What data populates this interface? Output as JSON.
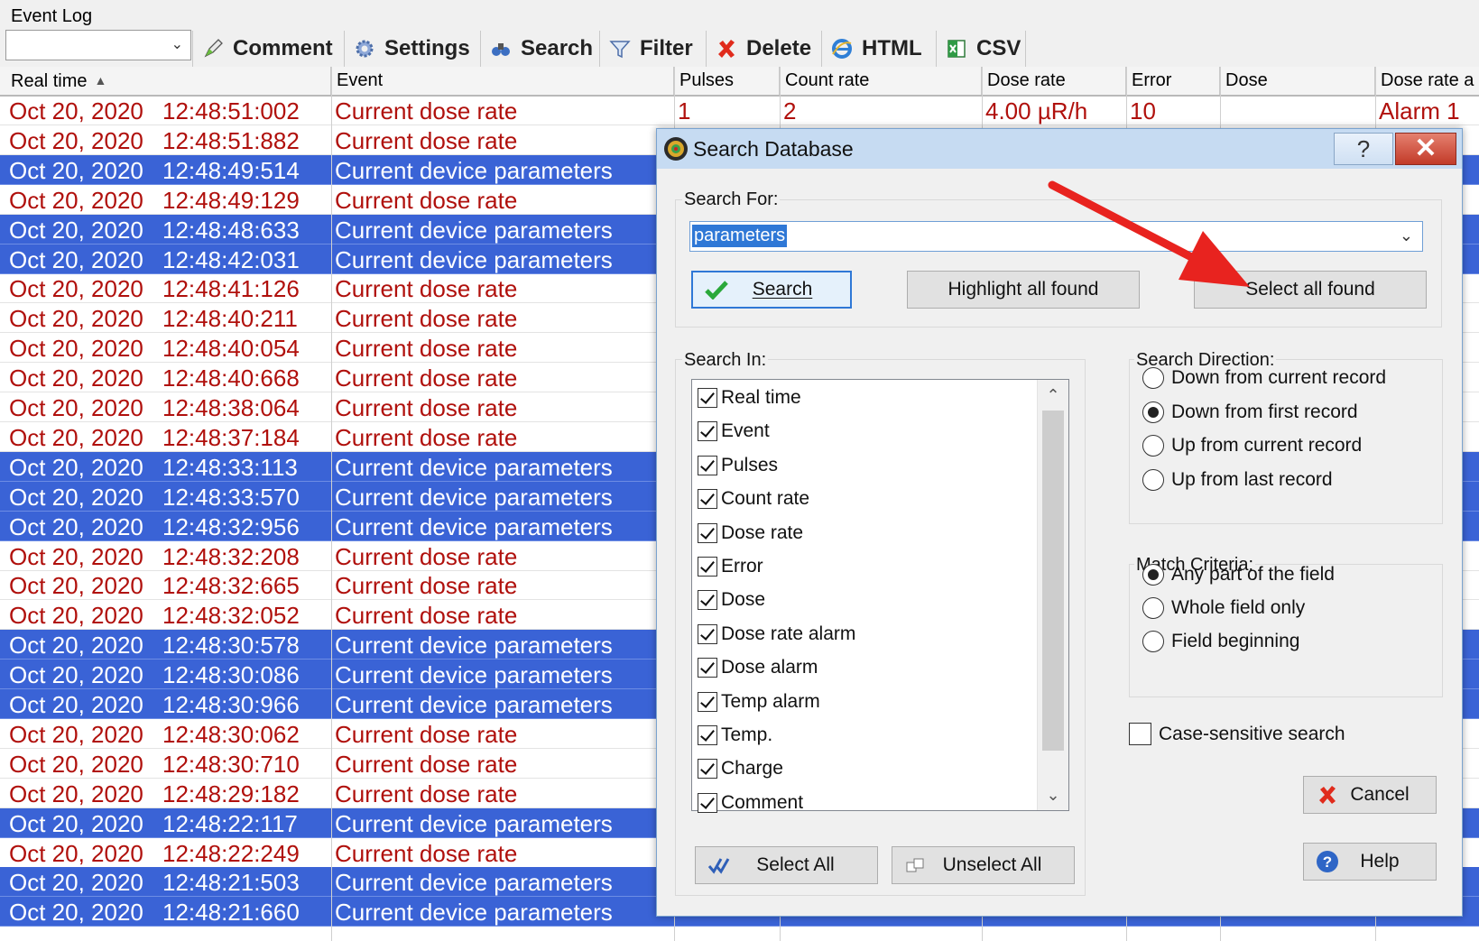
{
  "window": {
    "title": "Event Log"
  },
  "toolbar": {
    "combo_value": "",
    "buttons": [
      {
        "label": "Comment",
        "icon": "comment-icon"
      },
      {
        "label": "Settings",
        "icon": "gear-icon"
      },
      {
        "label": "Search",
        "icon": "binoculars-icon"
      },
      {
        "label": "Filter",
        "icon": "funnel-icon"
      },
      {
        "label": "Delete",
        "icon": "red-x-icon"
      },
      {
        "label": "HTML",
        "icon": "ie-icon"
      },
      {
        "label": "CSV",
        "icon": "excel-icon"
      }
    ]
  },
  "grid": {
    "columns": [
      "Real time",
      "Event",
      "Pulses",
      "Count rate",
      "Dose rate",
      "Error",
      "Dose",
      "Dose rate a"
    ],
    "sorted_column": "Real time",
    "colors": {
      "text": "#b0100c",
      "selected_bg": "#3a63d6",
      "selected_text": "#ffffff"
    },
    "first_row": {
      "pulses": "1",
      "count_rate": "2",
      "dose_rate": "4.00 µR/h",
      "error": "10",
      "dose": "",
      "alarm": "Alarm 1"
    },
    "rows": [
      {
        "date": "Oct 20, 2020",
        "time": "12:48:51:002",
        "event": "Current dose rate",
        "selected": false
      },
      {
        "date": "Oct 20, 2020",
        "time": "12:48:51:882",
        "event": "Current dose rate",
        "selected": false
      },
      {
        "date": "Oct 20, 2020",
        "time": "12:48:49:514",
        "event": "Current device parameters",
        "selected": true
      },
      {
        "date": "Oct 20, 2020",
        "time": "12:48:49:129",
        "event": "Current dose rate",
        "selected": false
      },
      {
        "date": "Oct 20, 2020",
        "time": "12:48:48:633",
        "event": "Current device parameters",
        "selected": true
      },
      {
        "date": "Oct 20, 2020",
        "time": "12:48:42:031",
        "event": "Current device parameters",
        "selected": true
      },
      {
        "date": "Oct 20, 2020",
        "time": "12:48:41:126",
        "event": "Current dose rate",
        "selected": false
      },
      {
        "date": "Oct 20, 2020",
        "time": "12:48:40:211",
        "event": "Current dose rate",
        "selected": false
      },
      {
        "date": "Oct 20, 2020",
        "time": "12:48:40:054",
        "event": "Current dose rate",
        "selected": false
      },
      {
        "date": "Oct 20, 2020",
        "time": "12:48:40:668",
        "event": "Current dose rate",
        "selected": false
      },
      {
        "date": "Oct 20, 2020",
        "time": "12:48:38:064",
        "event": "Current dose rate",
        "selected": false
      },
      {
        "date": "Oct 20, 2020",
        "time": "12:48:37:184",
        "event": "Current dose rate",
        "selected": false
      },
      {
        "date": "Oct 20, 2020",
        "time": "12:48:33:113",
        "event": "Current device parameters",
        "selected": true
      },
      {
        "date": "Oct 20, 2020",
        "time": "12:48:33:570",
        "event": "Current device parameters",
        "selected": true
      },
      {
        "date": "Oct 20, 2020",
        "time": "12:48:32:956",
        "event": "Current device parameters",
        "selected": true
      },
      {
        "date": "Oct 20, 2020",
        "time": "12:48:32:208",
        "event": "Current dose rate",
        "selected": false
      },
      {
        "date": "Oct 20, 2020",
        "time": "12:48:32:665",
        "event": "Current dose rate",
        "selected": false
      },
      {
        "date": "Oct 20, 2020",
        "time": "12:48:32:052",
        "event": "Current dose rate",
        "selected": false
      },
      {
        "date": "Oct 20, 2020",
        "time": "12:48:30:578",
        "event": "Current device parameters",
        "selected": true
      },
      {
        "date": "Oct 20, 2020",
        "time": "12:48:30:086",
        "event": "Current device parameters",
        "selected": true
      },
      {
        "date": "Oct 20, 2020",
        "time": "12:48:30:966",
        "event": "Current device parameters",
        "selected": true
      },
      {
        "date": "Oct 20, 2020",
        "time": "12:48:30:062",
        "event": "Current dose rate",
        "selected": false
      },
      {
        "date": "Oct 20, 2020",
        "time": "12:48:30:710",
        "event": "Current dose rate",
        "selected": false
      },
      {
        "date": "Oct 20, 2020",
        "time": "12:48:29:182",
        "event": "Current dose rate",
        "selected": false
      },
      {
        "date": "Oct 20, 2020",
        "time": "12:48:22:117",
        "event": "Current device parameters",
        "selected": true
      },
      {
        "date": "Oct 20, 2020",
        "time": "12:48:22:249",
        "event": "Current dose rate",
        "selected": false
      },
      {
        "date": "Oct 20, 2020",
        "time": "12:48:21:503",
        "event": "Current device parameters",
        "selected": true
      },
      {
        "date": "Oct 20, 2020",
        "time": "12:48:21:660",
        "event": "Current device parameters",
        "selected": true
      }
    ]
  },
  "dialog": {
    "title": "Search Database",
    "help_glyph": "?",
    "close_glyph": "✕",
    "search_for_label": "Search For:",
    "search_value": "parameters",
    "search_button": "Search",
    "highlight_button": "Highlight all found",
    "select_all_found_button": "Select all found",
    "search_in_label": "Search In:",
    "fields": [
      {
        "label": "Real time",
        "checked": true
      },
      {
        "label": "Event",
        "checked": true
      },
      {
        "label": "Pulses",
        "checked": true
      },
      {
        "label": "Count rate",
        "checked": true
      },
      {
        "label": "Dose rate",
        "checked": true
      },
      {
        "label": "Error",
        "checked": true
      },
      {
        "label": "Dose",
        "checked": true
      },
      {
        "label": "Dose rate alarm",
        "checked": true
      },
      {
        "label": "Dose alarm",
        "checked": true
      },
      {
        "label": "Temp alarm",
        "checked": true
      },
      {
        "label": "Temp.",
        "checked": true
      },
      {
        "label": "Charge",
        "checked": true
      },
      {
        "label": "Comment",
        "checked": true
      }
    ],
    "select_all_button": "Select All",
    "unselect_all_button": "Unselect All",
    "direction_label": "Search Direction:",
    "directions": [
      {
        "label": "Down from current record",
        "selected": false
      },
      {
        "label": "Down from first record",
        "selected": true
      },
      {
        "label": "Up from current record",
        "selected": false
      },
      {
        "label": "Up from last record",
        "selected": false
      }
    ],
    "match_label": "Match Criteria:",
    "matches": [
      {
        "label": "Any part of the field",
        "selected": true
      },
      {
        "label": "Whole field only",
        "selected": false
      },
      {
        "label": "Field beginning",
        "selected": false
      }
    ],
    "case_sensitive_label": "Case-sensitive search",
    "case_sensitive": false,
    "cancel_button": "Cancel",
    "help_button": "Help"
  },
  "annotation": {
    "color": "#e8231f"
  }
}
